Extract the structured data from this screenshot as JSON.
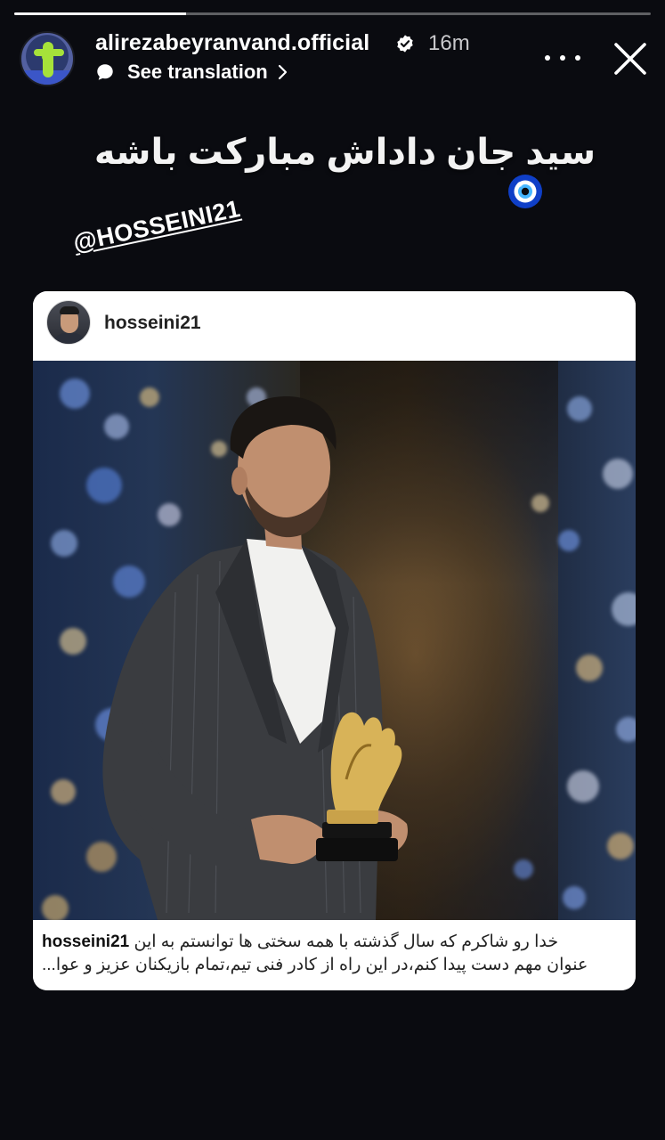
{
  "story": {
    "progress_fraction": 0.27,
    "user": {
      "username": "alirezabeyranvand.official",
      "verified": true,
      "time_ago": "16m",
      "avatar_icon": "avatar-goalkeeper"
    },
    "translation": {
      "label": "See translation",
      "icon": "speech-bubble-icon"
    },
    "controls": {
      "more_icon": "more-dots-icon",
      "close_icon": "close-x-icon"
    },
    "caption_text": "سید جان داداش مبارکت باشه",
    "sticker": "nazar-evil-eye-emoji",
    "mention": "@HOSSEINI21"
  },
  "shared_post": {
    "username": "hosseini21",
    "caption_username": "hosseini21",
    "caption_line1": "خدا رو شاکرم که سال گذشته با همه سختی ها توانستم به این",
    "caption_line2": "عنوان مهم دست پیدا کنم،در این راه از کادر فنی تیم،تمام بازیکنان عزیز و عوا..."
  },
  "colors": {
    "background": "#0a0b10",
    "verified_badge": "#ffffff",
    "card_bg": "#ffffff"
  }
}
